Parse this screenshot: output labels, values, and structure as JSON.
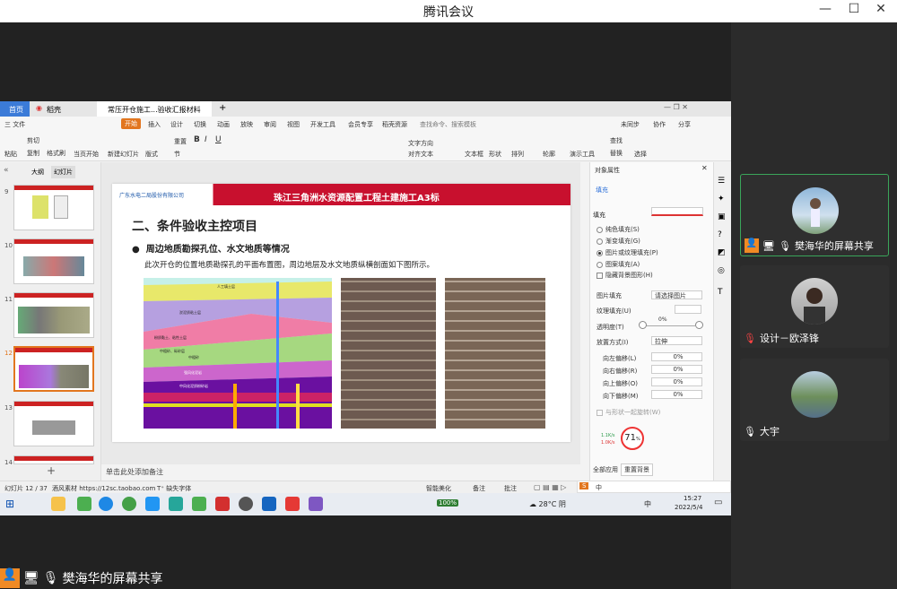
{
  "window": {
    "title": "腾讯会议"
  },
  "participants": [
    {
      "name": "樊海华的屏幕共享",
      "sharing": true
    },
    {
      "name": "设计－欧泽锋",
      "muted": true
    },
    {
      "name": "大宇",
      "muted": false
    }
  ],
  "bottom_label": "樊海华的屏幕共享",
  "wps": {
    "tabs": [
      "首页",
      "稻壳",
      "常压开仓施工...验收汇报材料"
    ],
    "menu": [
      "三 文件",
      "开始",
      "插入",
      "设计",
      "切换",
      "动画",
      "放映",
      "审阅",
      "视图",
      "开发工具",
      "会员专享",
      "稻壳资源",
      "查找命令、搜索模板",
      "未同步",
      "协作",
      "分享"
    ],
    "toolbar": {
      "paste": "粘贴",
      "cut": "剪切",
      "copy": "复制",
      "format_painter": "格式刷",
      "play_from_current": "当页开始",
      "new_slide": "新建幻灯片",
      "layout": "版式",
      "section": "节",
      "reset": "重置",
      "text_box": "文本框",
      "shape": "形状",
      "arrange": "排列",
      "outline": "轮廓",
      "present_tools": "演示工具",
      "find": "查找",
      "replace": "替换",
      "select": "选择",
      "textdir": "文字方向",
      "align": "对齐文本",
      "smart_art": "转智能图形"
    },
    "panel_tabs": [
      "大纲",
      "幻灯片"
    ],
    "thumb_numbers": [
      "9",
      "10",
      "11",
      "12",
      "13",
      "14"
    ],
    "slide": {
      "company": "广东水电二局股份有限公司",
      "banner": "珠江三角洲水资源配置工程土建施工A3标",
      "heading": "二、条件验收主控项目",
      "bullet": "周边地质勘探孔位、水文地质等情况",
      "body": "此次开仓的位置地质勘探孔的平面布置图，周边地层及水文地质纵横剖面如下图所示。",
      "geo_labels": [
        "人工填土层",
        "淤泥质粘土层",
        "粉质黏土、粘性土层",
        "中粗砂",
        "中粗砂、砾砂层",
        "强风化泥岩",
        "中风化泥质粉砂岩"
      ]
    },
    "notes": "单击此处添加备注",
    "props": {
      "title": "对象属性",
      "tab": "填充",
      "fill_section": "填充",
      "options": [
        "纯色填充(S)",
        "渐变填充(G)",
        "图片或纹理填充(P)",
        "图案填充(A)",
        "隐藏背景图形(H)"
      ],
      "picture_fill_label": "图片填充",
      "picture_fill_value": "请选择图片",
      "texture_label": "纹理填充(U)",
      "transparency_label": "透明度(T)",
      "transparency_value": "0%",
      "placement_label": "放置方式(I)",
      "placement_value": "拉伸",
      "offsets": [
        {
          "label": "向左偏移(L)",
          "value": "0%"
        },
        {
          "label": "向右偏移(R)",
          "value": "0%"
        },
        {
          "label": "向上偏移(O)",
          "value": "0%"
        },
        {
          "label": "向下偏移(M)",
          "value": "0%"
        }
      ],
      "rotate": "与形状一起旋转(W)",
      "apply_all": "全部应用",
      "reset_bg": "重置背景",
      "speed_up": "1.1K/s",
      "speed_down": "1.0K/s",
      "percent": "71",
      "percent_unit": "%"
    },
    "status": {
      "slide_count": "幻灯片 12 / 37",
      "theme": "酒风素材 https://12sc.taobao.com",
      "missing_font": "缺失字体",
      "smart_beautify": "智能美化",
      "notes_btn": "备注",
      "comments_btn": "批注"
    }
  },
  "taskbar": {
    "battery": "100%",
    "weather": "28°C 阴",
    "ime": "中",
    "time": "15:27",
    "date": "2022/5/4"
  }
}
